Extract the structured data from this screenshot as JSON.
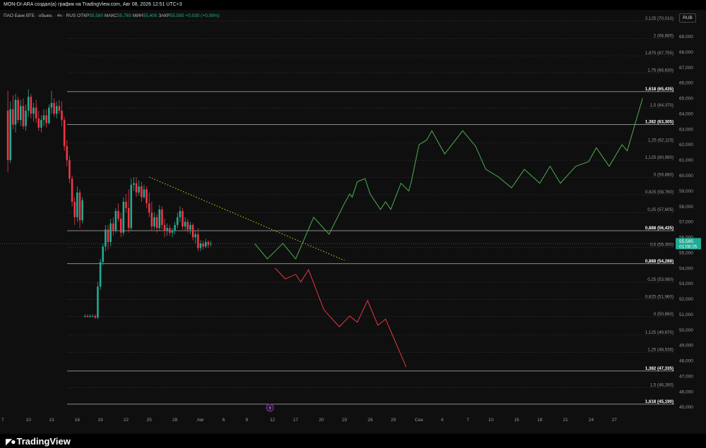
{
  "header": {
    "author_line": "MON-DI-ARA создал(а) график на TradingView.com, Авг 08, 2026 12:51 UTC+3"
  },
  "legend": {
    "symbol": "ПАО Банк ВТБ · обыкн. · 4ч · RUS",
    "open_label": "ОТКР",
    "open_value": "55,580",
    "high_label": "МАКС",
    "high_value": "55,765",
    "low_label": "МИН",
    "low_value": "55,405",
    "close_label": "ЗАКР",
    "close_value": "55,585",
    "change_value": "+0,035 (+0,06%)"
  },
  "currency": "RUB",
  "price_badge": {
    "price": "55,585",
    "timer": "01:08:25"
  },
  "footer": {
    "brand": "TradingView"
  },
  "colors": {
    "bg": "#0f0f0f",
    "up": "#22ab94",
    "down": "#f23645",
    "bullish_path": "#4caf50",
    "bearish_path": "#e53945",
    "trendline": "#d4d400",
    "fib_line": "#434651",
    "axis_text": "#9598a1"
  },
  "chart_data": {
    "type": "candlestick",
    "y_axis": {
      "min": 45,
      "max": 70,
      "step": 1,
      "ticks": [
        "70,000",
        "69,000",
        "68,000",
        "67,000",
        "66,000",
        "65,000",
        "64,000",
        "63,000",
        "62,000",
        "61,000",
        "60,000",
        "59,000",
        "58,000",
        "57,000",
        "56,000",
        "55,000",
        "54,000",
        "53,000",
        "52,000",
        "51,000",
        "50,000",
        "49,000",
        "48,000",
        "47,000",
        "46,000",
        "45,000"
      ],
      "tick_values": [
        70,
        69,
        68,
        67,
        66,
        65,
        64,
        63,
        62,
        61,
        60,
        59,
        58,
        57,
        56,
        55,
        54,
        53,
        52,
        51,
        50,
        49,
        48,
        47,
        46,
        45
      ]
    },
    "x_axis": {
      "labels": [
        "7",
        "10",
        "13",
        "16",
        "19",
        "22",
        "25",
        "28",
        "Авг",
        "6",
        "9",
        "12",
        "17",
        "20",
        "23",
        "26",
        "29",
        "Сен",
        "4",
        "7",
        "10",
        "15",
        "18",
        "21",
        "24",
        "27"
      ],
      "label_index": [
        0,
        10,
        19,
        29,
        38,
        48,
        57,
        67,
        77,
        86,
        95,
        105,
        114,
        124,
        133,
        143,
        152,
        162,
        171,
        181,
        190,
        200,
        209,
        219,
        229,
        238
      ]
    },
    "fib_levels": [
      {
        "label": "2,125 (70,010)",
        "price": 70.01,
        "emphasis": false
      },
      {
        "label": "2 (68,885)",
        "price": 68.885,
        "emphasis": false
      },
      {
        "label": "1,875 (67,755)",
        "price": 67.755,
        "emphasis": false
      },
      {
        "label": "1,75 (66,630)",
        "price": 66.63,
        "emphasis": false
      },
      {
        "label": "1,618 (65,435)",
        "price": 65.435,
        "emphasis": true
      },
      {
        "label": "1,5 (64,370)",
        "price": 64.37,
        "emphasis": false
      },
      {
        "label": "1,382 (63,305)",
        "price": 63.305,
        "emphasis": true
      },
      {
        "label": "1,25 (62,115)",
        "price": 62.115,
        "emphasis": false
      },
      {
        "label": "1,125 (60,990)",
        "price": 60.99,
        "emphasis": false
      },
      {
        "label": "0 (59,880)",
        "price": 59.88,
        "emphasis": false
      },
      {
        "label": "0,825 (58,760)",
        "price": 58.76,
        "emphasis": false
      },
      {
        "label": "0,25 (57,605)",
        "price": 57.605,
        "emphasis": false
      },
      {
        "label": "0,888 (56,425)",
        "price": 56.425,
        "emphasis": true
      },
      {
        "label": "0,5 (55,350)",
        "price": 55.35,
        "emphasis": false
      },
      {
        "label": "0,888 (54,288)",
        "price": 54.288,
        "emphasis": true
      },
      {
        "label": "0,25 (53,080)",
        "price": 53.08,
        "emphasis": false
      },
      {
        "label": "0,825 (51,960)",
        "price": 51.96,
        "emphasis": false
      },
      {
        "label": "0 (50,860)",
        "price": 50.86,
        "emphasis": false
      },
      {
        "label": "1,125 (49,670)",
        "price": 49.67,
        "emphasis": false
      },
      {
        "label": "1,25 (48,535)",
        "price": 48.535,
        "emphasis": false
      },
      {
        "label": "1,382 (47,335)",
        "price": 47.335,
        "emphasis": true
      },
      {
        "label": "1,5 (46,260)",
        "price": 46.26,
        "emphasis": false
      },
      {
        "label": "1,618 (45,190)",
        "price": 45.19,
        "emphasis": true
      }
    ],
    "candles_note": "OHLC per bar, bar index = time",
    "candles": [
      [
        64.2,
        65.5,
        60.2,
        61.0
      ],
      [
        61.0,
        64.8,
        60.8,
        64.3
      ],
      [
        64.3,
        65.2,
        63.0,
        63.3
      ],
      [
        63.3,
        65.3,
        62.8,
        64.9
      ],
      [
        64.9,
        65.1,
        63.4,
        63.6
      ],
      [
        63.6,
        64.9,
        63.2,
        64.5
      ],
      [
        64.5,
        65.0,
        63.0,
        63.2
      ],
      [
        63.2,
        64.6,
        62.9,
        64.2
      ],
      [
        64.2,
        65.6,
        63.8,
        65.1
      ],
      [
        65.1,
        65.3,
        63.7,
        64.0
      ],
      [
        64.0,
        64.7,
        63.5,
        64.4
      ],
      [
        64.4,
        64.9,
        63.4,
        63.7
      ],
      [
        63.7,
        64.2,
        62.9,
        63.1
      ],
      [
        63.1,
        63.9,
        62.8,
        63.6
      ],
      [
        63.6,
        64.3,
        63.2,
        63.9
      ],
      [
        63.9,
        64.3,
        63.1,
        63.4
      ],
      [
        63.4,
        64.6,
        63.3,
        64.4
      ],
      [
        64.4,
        65.5,
        64.0,
        64.7
      ],
      [
        64.7,
        65.0,
        63.8,
        64.0
      ],
      [
        64.0,
        64.8,
        63.7,
        64.5
      ],
      [
        64.5,
        64.9,
        64.0,
        64.2
      ],
      [
        64.2,
        64.8,
        63.2,
        63.6
      ],
      [
        63.6,
        63.8,
        61.6,
        61.9
      ],
      [
        61.9,
        62.3,
        60.6,
        61.0
      ],
      [
        61.0,
        61.3,
        59.5,
        59.8
      ],
      [
        59.8,
        60.0,
        58.0,
        58.3
      ],
      [
        58.3,
        58.6,
        56.8,
        57.3
      ],
      [
        57.3,
        59.3,
        57.0,
        58.9
      ],
      [
        58.9,
        59.1,
        56.6,
        57.1
      ],
      [
        57.1,
        58.6,
        56.9,
        58.4
      ],
      [
        50.9,
        51.0,
        50.8,
        50.9
      ],
      [
        50.9,
        51.0,
        50.8,
        50.85
      ],
      [
        50.85,
        51.0,
        50.8,
        50.9
      ],
      [
        50.9,
        51.0,
        50.8,
        50.9
      ],
      [
        50.9,
        51.0,
        50.7,
        50.8
      ],
      [
        50.8,
        53.1,
        50.7,
        52.8
      ],
      [
        52.8,
        54.6,
        52.6,
        54.4
      ],
      [
        54.4,
        55.6,
        54.2,
        55.4
      ],
      [
        55.4,
        56.8,
        55.1,
        56.5
      ],
      [
        56.5,
        56.8,
        55.2,
        55.7
      ],
      [
        55.7,
        57.2,
        55.4,
        56.9
      ],
      [
        56.9,
        57.3,
        56.1,
        56.4
      ],
      [
        56.4,
        57.9,
        56.3,
        57.7
      ],
      [
        57.7,
        58.2,
        57.0,
        57.2
      ],
      [
        57.2,
        57.6,
        56.0,
        56.3
      ],
      [
        56.3,
        58.6,
        56.1,
        58.3
      ],
      [
        58.3,
        58.8,
        57.6,
        57.9
      ],
      [
        57.9,
        59.1,
        56.3,
        56.6
      ],
      [
        56.6,
        59.8,
        56.4,
        59.4
      ],
      [
        59.4,
        59.9,
        59.0,
        59.5
      ],
      [
        59.5,
        59.9,
        58.6,
        58.9
      ],
      [
        58.9,
        59.7,
        58.7,
        59.3
      ],
      [
        59.3,
        59.6,
        58.3,
        58.6
      ],
      [
        58.6,
        59.4,
        58.5,
        59.1
      ],
      [
        59.1,
        59.3,
        57.9,
        58.2
      ],
      [
        58.2,
        58.9,
        57.3,
        57.6
      ],
      [
        57.6,
        58.3,
        56.4,
        56.7
      ],
      [
        56.7,
        57.6,
        56.5,
        57.3
      ],
      [
        57.3,
        57.5,
        56.3,
        56.6
      ],
      [
        56.6,
        58.1,
        56.4,
        57.8
      ],
      [
        57.8,
        58.0,
        56.5,
        56.8
      ],
      [
        56.8,
        57.2,
        56.0,
        56.4
      ],
      [
        56.4,
        56.9,
        56.1,
        56.6
      ],
      [
        56.6,
        56.8,
        56.1,
        56.3
      ],
      [
        56.3,
        56.6,
        56.0,
        56.4
      ],
      [
        56.4,
        57.0,
        56.2,
        56.8
      ],
      [
        56.8,
        57.6,
        56.6,
        57.3
      ],
      [
        57.3,
        58.0,
        57.0,
        57.7
      ],
      [
        57.7,
        57.9,
        56.5,
        56.7
      ],
      [
        56.7,
        57.3,
        56.4,
        57.0
      ],
      [
        57.0,
        57.2,
        56.3,
        56.5
      ],
      [
        56.5,
        57.0,
        56.2,
        56.8
      ],
      [
        56.8,
        56.9,
        55.8,
        56.0
      ],
      [
        56.0,
        56.4,
        55.6,
        56.2
      ],
      [
        56.2,
        56.6,
        55.1,
        55.3
      ],
      [
        55.3,
        55.8,
        55.1,
        55.6
      ],
      [
        55.6,
        55.8,
        55.2,
        55.4
      ],
      [
        55.4,
        55.9,
        55.3,
        55.7
      ],
      [
        55.7,
        55.8,
        55.3,
        55.5
      ],
      [
        55.58,
        55.765,
        55.405,
        55.585
      ]
    ],
    "candle_x_start": 2,
    "trendline": {
      "from": {
        "bar": 57,
        "price": 59.9
      },
      "to": {
        "bar": 133,
        "price": 54.5
      }
    },
    "bullish_path": {
      "name": "",
      "points": [
        [
          98,
          55.6
        ],
        [
          103,
          54.6
        ],
        [
          109,
          55.6
        ],
        [
          114,
          54.6
        ],
        [
          121,
          57.3
        ],
        [
          127,
          56.2
        ],
        [
          133,
          58.2
        ],
        [
          135,
          58.8
        ],
        [
          136,
          58.6
        ],
        [
          138,
          59.6
        ],
        [
          141,
          59.8
        ],
        [
          143,
          58.8
        ],
        [
          147,
          57.8
        ],
        [
          149,
          58.3
        ],
        [
          151,
          57.8
        ],
        [
          155,
          59.5
        ],
        [
          158,
          59.0
        ],
        [
          159,
          59.6
        ],
        [
          162,
          62.0
        ],
        [
          165,
          62.3
        ],
        [
          167,
          62.9
        ],
        [
          172,
          61.4
        ],
        [
          179,
          62.9
        ],
        [
          184,
          61.9
        ],
        [
          188,
          60.4
        ],
        [
          193,
          59.9
        ],
        [
          198,
          59.2
        ],
        [
          203,
          60.4
        ],
        [
          209,
          59.5
        ],
        [
          213,
          60.6
        ],
        [
          217,
          59.5
        ],
        [
          223,
          60.6
        ],
        [
          228,
          60.9
        ],
        [
          231,
          61.8
        ],
        [
          236,
          60.6
        ],
        [
          241,
          62.0
        ],
        [
          243,
          61.6
        ],
        [
          249,
          65.0
        ]
      ]
    },
    "bearish_path": {
      "name": "",
      "points": [
        [
          106,
          54.0
        ],
        [
          110,
          53.3
        ],
        [
          114,
          53.6
        ],
        [
          116,
          53.1
        ],
        [
          119,
          53.9
        ],
        [
          125,
          51.3
        ],
        [
          131,
          50.2
        ],
        [
          135,
          50.9
        ],
        [
          138,
          50.5
        ],
        [
          142,
          51.9
        ],
        [
          146,
          50.3
        ],
        [
          149,
          50.7
        ],
        [
          157,
          47.6
        ]
      ]
    }
  }
}
